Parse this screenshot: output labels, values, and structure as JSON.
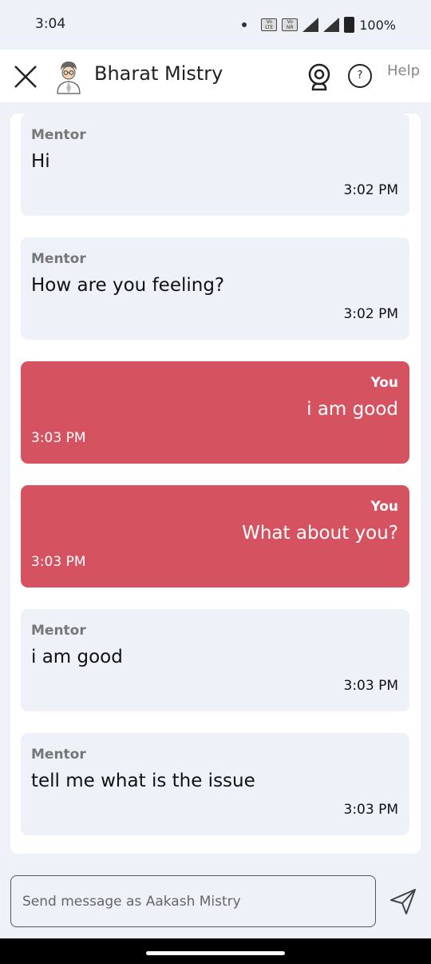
{
  "status_bar": {
    "time": "3:04",
    "sim1": "Vo LTE",
    "sim2": "Vo NR",
    "battery": "100%"
  },
  "header": {
    "title": "Bharat Mistry",
    "help_label": "Help",
    "help_icon_text": "?"
  },
  "messages": [
    {
      "role": "mentor",
      "sender": "Mentor",
      "text": "Hi",
      "time": "3:02 PM"
    },
    {
      "role": "mentor",
      "sender": "Mentor",
      "text": "How are you feeling?",
      "time": "3:02 PM"
    },
    {
      "role": "you",
      "sender": "You",
      "text": "i am good",
      "time": "3:03 PM"
    },
    {
      "role": "you",
      "sender": "You",
      "text": "What about you?",
      "time": "3:03 PM"
    },
    {
      "role": "mentor",
      "sender": "Mentor",
      "text": "i am good",
      "time": "3:03 PM"
    },
    {
      "role": "mentor",
      "sender": "Mentor",
      "text": "tell me what is the issue",
      "time": "3:03 PM"
    }
  ],
  "composer": {
    "placeholder": "Send message as Aakash Mistry",
    "value": ""
  },
  "colors": {
    "you_bubble": "#d55361",
    "mentor_bubble": "#eef1f7",
    "background": "#eef1f7"
  }
}
